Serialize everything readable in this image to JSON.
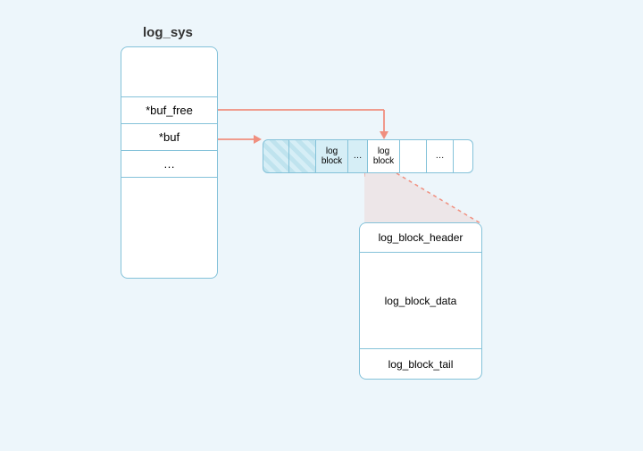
{
  "title": "log_sys",
  "struct_fields": {
    "buf_free": "*buf_free",
    "buf": "*buf",
    "ellipsis": "…"
  },
  "buffer": {
    "named1": "log block",
    "dots1": "…",
    "named_focus": "log block",
    "dots2": "…"
  },
  "detail": {
    "header": "log_block_header",
    "data": "log_block_data",
    "tail": "log_block_tail"
  }
}
